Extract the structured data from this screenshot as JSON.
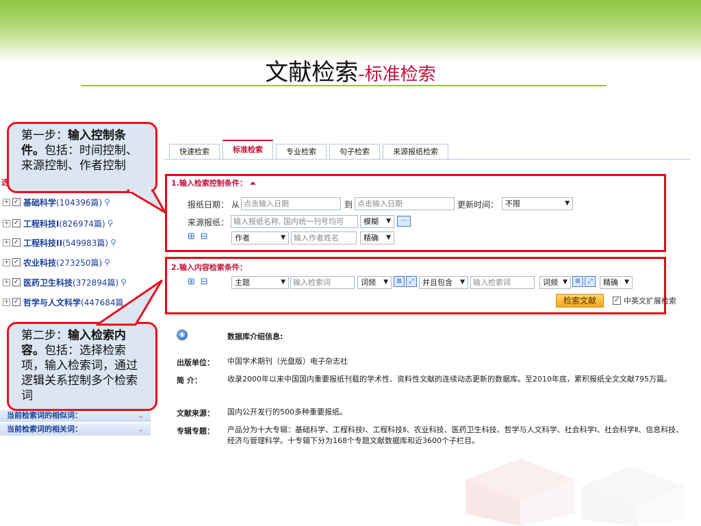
{
  "title": {
    "main": "文献检索",
    "sub": "-标准检索"
  },
  "tabs": [
    {
      "label": "快速检索",
      "active": false
    },
    {
      "label": "标准检索",
      "active": true
    },
    {
      "label": "专业检索",
      "active": false
    },
    {
      "label": "句子检索",
      "active": false
    },
    {
      "label": "来源报纸检索",
      "active": false
    }
  ],
  "tree": {
    "partial_label": "选",
    "items": [
      {
        "name": "基础科学",
        "count": "(104396篇)"
      },
      {
        "name": "工程科技I",
        "count": "(826974篇)"
      },
      {
        "name": "工程科技II",
        "count": "(549983篇)"
      },
      {
        "name": "农业科技",
        "count": "(273250篇)"
      },
      {
        "name": "医药卫生科技",
        "count": "(372894篇)"
      },
      {
        "name": "哲学与人文科学",
        "count": "(447684篇"
      }
    ],
    "similar_label": "当前检索词的相似词：",
    "related_label": "当前检索词的相关词："
  },
  "callouts": {
    "step1": {
      "prefix": "第一步：",
      "bold": "输入控制条件。",
      "rest": "包括：时间控制、来源控制、作者控制"
    },
    "step2": {
      "prefix": "第二步：",
      "bold": "输入检索内容。",
      "rest": "包括：选择检索项，输入检索词，通过逻辑关系控制多个检索词"
    }
  },
  "control": {
    "section_title": "1.输入检索控制条件：",
    "date_label": "报纸日期：",
    "from_label": "从",
    "date_from_placeholder": "点击输入日期",
    "to_label": "到",
    "date_to_placeholder": "点击输入日期",
    "update_label": "更新时间：",
    "update_value": "不限",
    "source_label": "来源报纸：",
    "source_placeholder": "输入报纸名称, 国内统一刊号均可",
    "source_match": "模糊",
    "more_glyph": "···",
    "author_field": "作者",
    "author_placeholder": "输入作者姓名",
    "author_match": "精确",
    "plus": "⊞",
    "minus": "⊟"
  },
  "content": {
    "section_title": "2.输入内容检索条件：",
    "field": "主题",
    "keyword_placeholder": "输入检索词",
    "freq1": "词频",
    "logic": "并且包含",
    "keyword2_placeholder": "输入检索词",
    "freq2": "词频",
    "match": "精确",
    "search_button": "检索文献",
    "expand_label": "中英文扩展检索"
  },
  "info": {
    "heading": "数据库介绍信息:",
    "publisher_label": "出版单位：",
    "publisher_value": "中国学术期刊（光盘版）电子杂志社",
    "summary_label": "简  介：",
    "summary_value": "收录2000年以来中国国内重要报纸刊载的学术性、资料性文献的连续动态更新的数据库。至2010年底，累积报纸全文文献795万篇。",
    "source_label": "文献来源：",
    "source_value": "国内公开发行的500多种重要报纸。",
    "topics_label": "专辑专题：",
    "topics_value": "产品分为十大专辑：基础科学、工程科技Ⅰ、工程科技Ⅱ、农业科技、医药卫生科技、哲学与人文科学、社会科学Ⅰ、社会科学Ⅱ、信息科技、经济与管理科学。十专辑下分为168个专题文献数据库和近3600个子栏目。"
  },
  "colors": {
    "accent_green": "#8cc63f",
    "alert_red": "#e00a14",
    "title_red": "#c0143c",
    "link_blue": "#1c3f9a"
  }
}
